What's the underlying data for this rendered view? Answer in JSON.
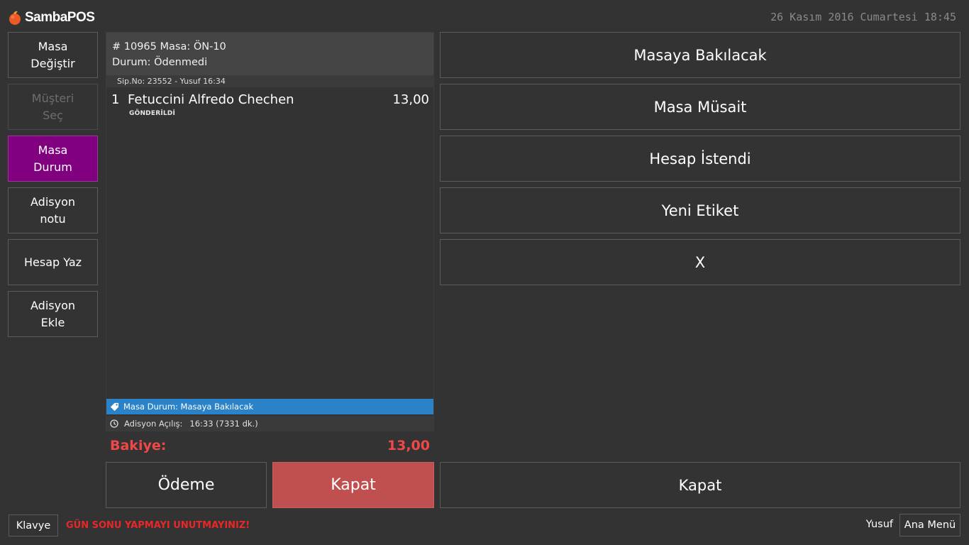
{
  "app": {
    "logo_text": "SambaPOS",
    "datetime": "26 Kasım 2016 Cumartesi 18:45"
  },
  "sidebar": {
    "items": [
      {
        "label": "Masa\nDeğiştir",
        "state": "normal"
      },
      {
        "label": "Müşteri\nSeç",
        "state": "disabled"
      },
      {
        "label": "Masa\nDurum",
        "state": "active"
      },
      {
        "label": "Adisyon\nnotu",
        "state": "normal"
      },
      {
        "label": "Hesap Yaz",
        "state": "normal"
      },
      {
        "label": "Adisyon\nEkle",
        "state": "normal"
      }
    ]
  },
  "ticket": {
    "header_line1": "# 10965 Masa: ÖN-10",
    "header_line2": "Durum: Ödenmedi",
    "order_info": "Sip.No: 23552 - Yusuf 16:34",
    "items": [
      {
        "qty": "1",
        "name": "Fetuccini Alfredo Chechen",
        "price": "13,00",
        "state": "GÖNDERİLDİ"
      }
    ],
    "tag_text": "Masa Durum: Masaya Bakılacak",
    "opened_label": "Adisyon Açılış:",
    "opened_value": "16:33 (7331 dk.)",
    "balance_label": "Bakiye:",
    "balance_value": "13,00"
  },
  "actions": {
    "payment_label": "Ödeme",
    "close_label": "Kapat"
  },
  "status_buttons": [
    "Masaya Bakılacak",
    "Masa Müsait",
    "Hesap İstendi",
    "Yeni Etiket",
    "X"
  ],
  "right_close_label": "Kapat",
  "footer": {
    "keyboard_label": "Klavye",
    "warning": "GÜN SONU YAPMAYI UNUTMAYINIZ!",
    "user": "Yusuf",
    "main_menu_label": "Ana Menü"
  },
  "colors": {
    "background": "#333333",
    "active": "#800080",
    "tag_bar": "#2a82c8",
    "close_button": "#c05050",
    "balance": "#f04848",
    "warning": "#e82828"
  }
}
